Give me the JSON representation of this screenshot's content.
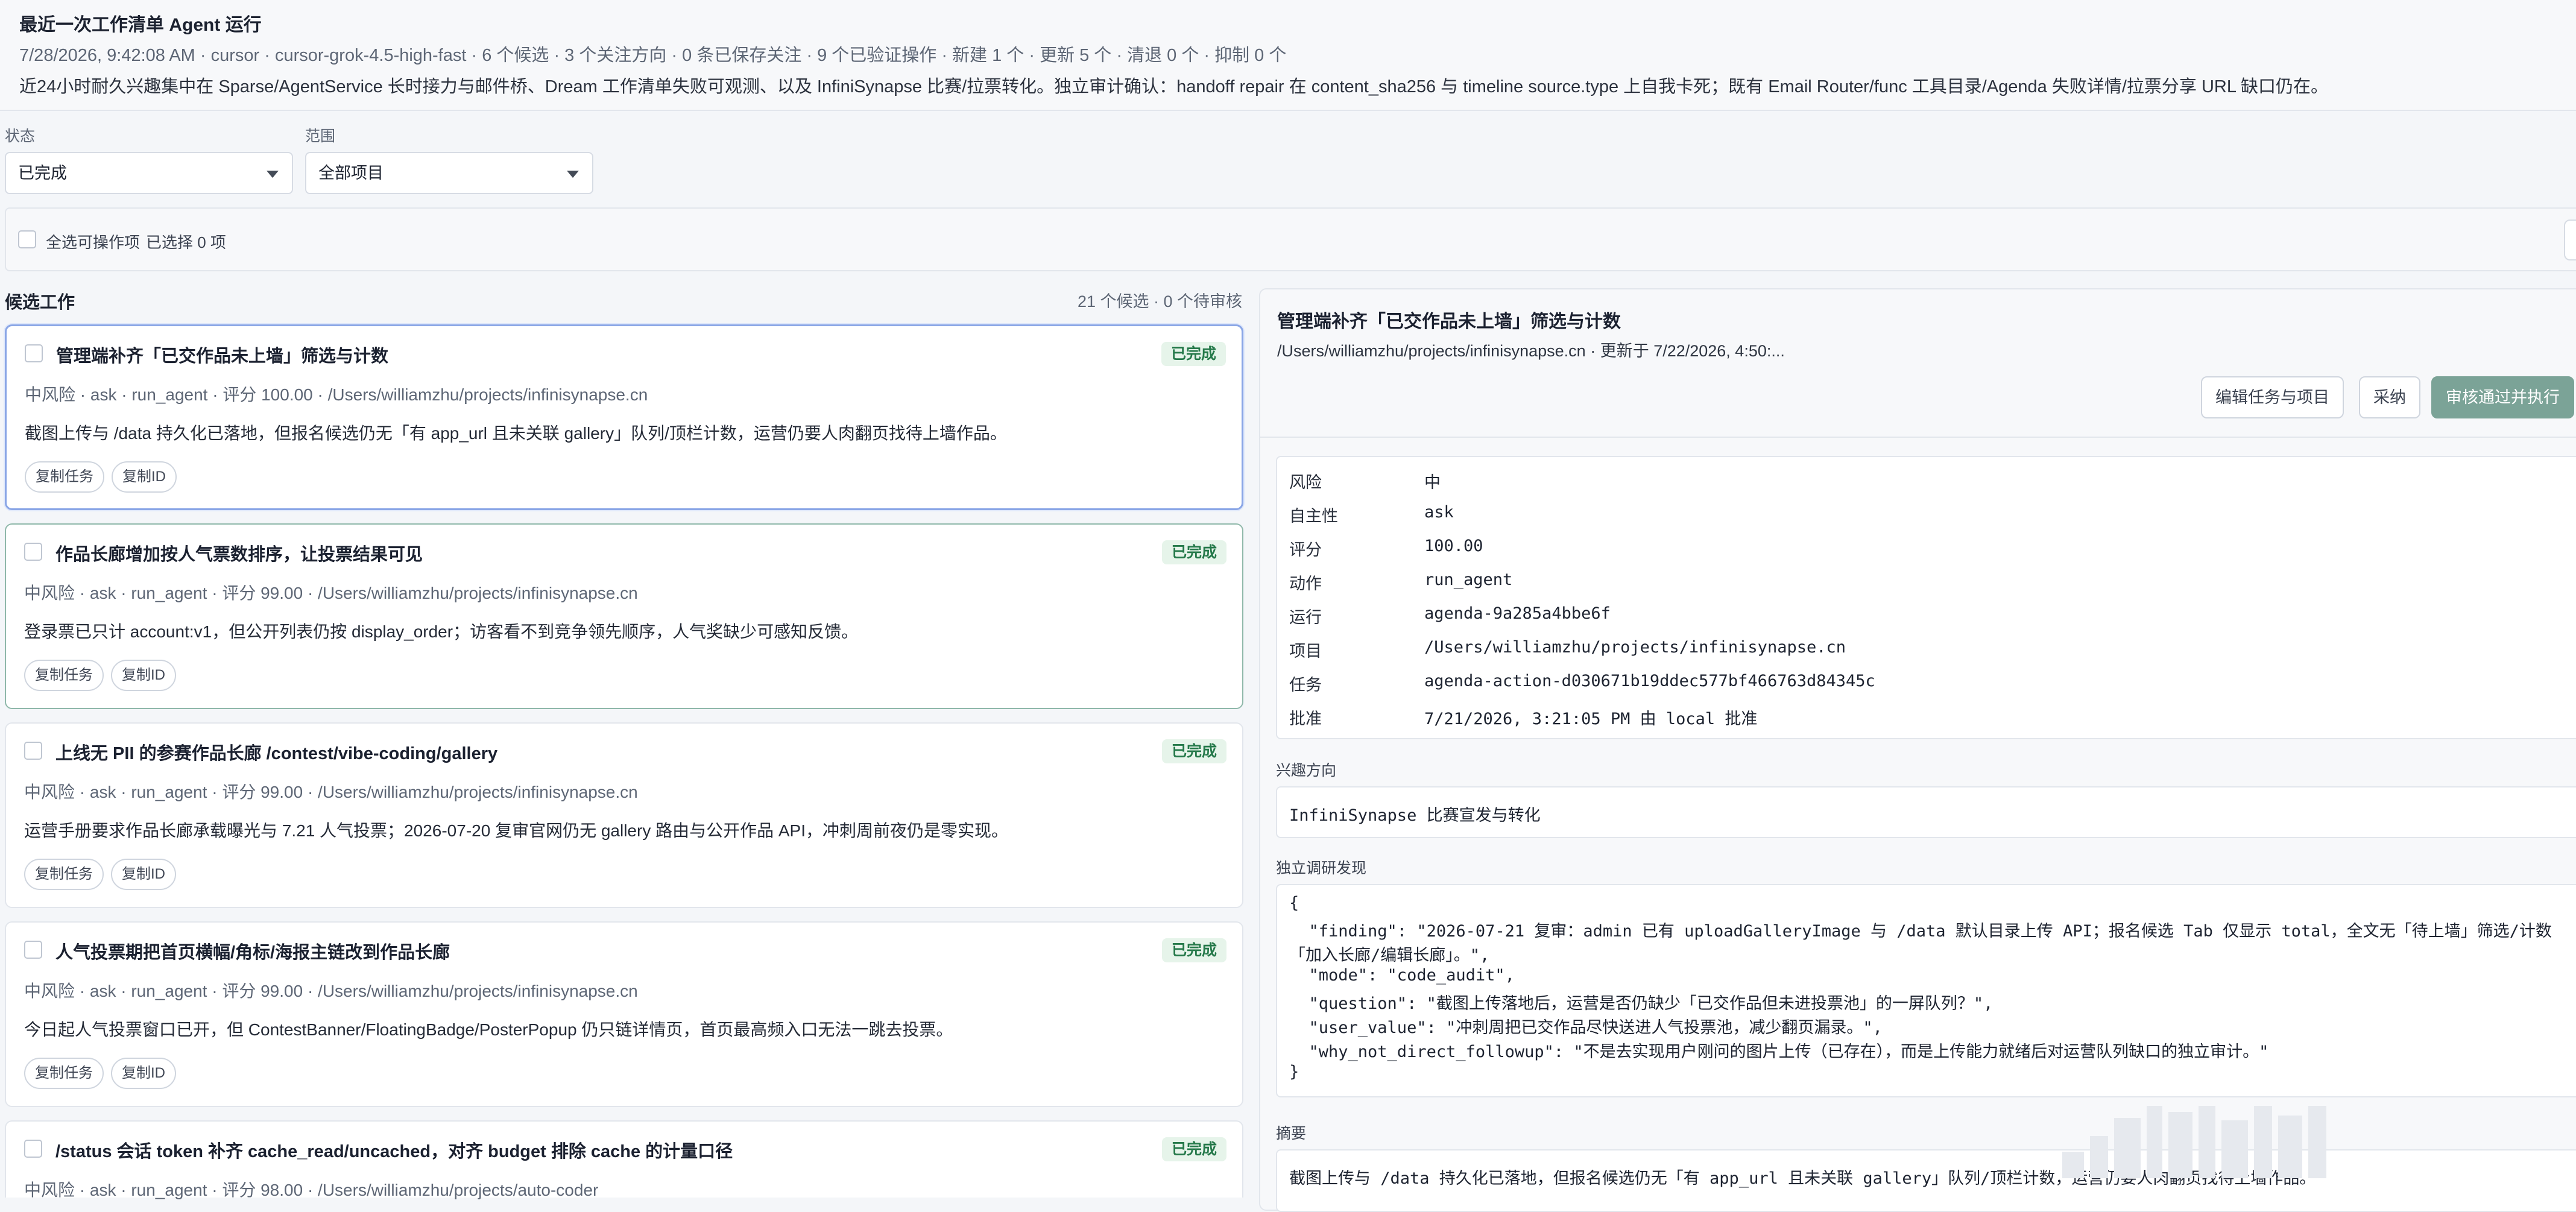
{
  "header": {
    "title": "最近一次工作清单 Agent 运行",
    "meta": "7/28/2026, 9:42:08 AM · cursor · cursor-grok-4.5-high-fast · 6 个候选 · 3 个关注方向 · 0 条已保存关注 · 9 个已验证操作 · 新建 1 个 · 更新 5 个 · 清退 0 个 · 抑制 0 个",
    "summary": "近24小时耐久兴趣集中在 Sparse/AgentService 长时接力与邮件桥、Dream 工作清单失败可观测、以及 InfiniSynapse 比赛/拉票转化。独立审计确认：handoff repair 在 content_sha256 与 timeline source.type 上自我卡死；既有 Email Router/func 工具目录/Agenda 失败详情/拉票分享 URL 缺口仍在。"
  },
  "filters": {
    "status_label": "状态",
    "status_value": "已完成",
    "scope_label": "范围",
    "scope_value": "全部项目"
  },
  "bulk": {
    "select_all_label": "全选可操作项",
    "selected_count": "已选择 0 项"
  },
  "list": {
    "title": "候选工作",
    "counts": "21 个候选 · 0 个待审核",
    "copy_task_label": "复制任务",
    "copy_id_label": "复制ID",
    "items": [
      {
        "title": "管理端补齐「已交作品未上墙」筛选与计数",
        "status": "已完成",
        "meta": "中风险 · ask · run_agent · 评分 100.00 · /Users/williamzhu/projects/infinisynapse.cn",
        "desc": "截图上传与 /data 持久化已落地，但报名候选仍无「有 app_url 且未关联 gallery」队列/顶栏计数，运营仍要人肉翻页找待上墙作品。"
      },
      {
        "title": "作品长廊增加按人气票数排序，让投票结果可见",
        "status": "已完成",
        "meta": "中风险 · ask · run_agent · 评分 99.00 · /Users/williamzhu/projects/infinisynapse.cn",
        "desc": "登录票已只计 account:v1，但公开列表仍按 display_order；访客看不到竞争领先顺序，人气奖缺少可感知反馈。"
      },
      {
        "title": "上线无 PII 的参赛作品长廊 /contest/vibe-coding/gallery",
        "status": "已完成",
        "meta": "中风险 · ask · run_agent · 评分 99.00 · /Users/williamzhu/projects/infinisynapse.cn",
        "desc": "运营手册要求作品长廊承载曝光与 7.21 人气投票；2026-07-20 复审官网仍无 gallery 路由与公开作品 API，冲刺周前夜仍是零实现。"
      },
      {
        "title": "人气投票期把首页横幅/角标/海报主链改到作品长廊",
        "status": "已完成",
        "meta": "中风险 · ask · run_agent · 评分 99.00 · /Users/williamzhu/projects/infinisynapse.cn",
        "desc": "今日起人气投票窗口已开，但 ContestBanner/FloatingBadge/PosterPopup 仍只链详情页，首页最高频入口无法一跳去投票。"
      },
      {
        "title": "/status 会话 token 补齐 cache_read/uncached，对齐 budget 排除 cache 的计量口径",
        "status": "已完成",
        "meta": "中风险 · ask · run_agent · 评分 98.00 · /Users/williamzhu/projects/auto-coder",
        "desc": ""
      }
    ]
  },
  "detail": {
    "title": "管理端补齐「已交作品未上墙」筛选与计数",
    "subtitle": "/Users/williamzhu/projects/infinisynapse.cn · 更新于 7/22/2026, 4:50:...",
    "edit_button": "编辑任务与项目",
    "adopt_button": "采纳",
    "approve_button": "审核通过并执行",
    "fields": [
      {
        "key": "风险",
        "value": "中"
      },
      {
        "key": "自主性",
        "value": "ask"
      },
      {
        "key": "评分",
        "value": "100.00"
      },
      {
        "key": "动作",
        "value": "run_agent"
      },
      {
        "key": "运行",
        "value": "agenda-9a285a4bbe6f"
      },
      {
        "key": "项目",
        "value": "/Users/williamzhu/projects/infinisynapse.cn"
      },
      {
        "key": "任务",
        "value": "agenda-action-d030671b19ddec577bf466763d84345c"
      },
      {
        "key": "批准",
        "value": "7/21/2026, 3:21:05 PM 由 local 批准"
      }
    ],
    "interest_label": "兴趣方向",
    "interest_value": "InfiniSynapse 比赛宣发与转化",
    "finding_label": "独立调研发现",
    "finding_lines": [
      "{",
      "  \"finding\": \"2026-07-21 复审：admin 已有 uploadGalleryImage 与 /data 默认目录上传 API；报名候选 Tab 仅显示 total，全文无「待上墙」筛选/计数",
      "「加入长廊/编辑长廊」。\",",
      "  \"mode\": \"code_audit\",",
      "  \"question\": \"截图上传落地后，运营是否仍缺少「已交作品但未进投票池」的一屏队列？\",",
      "  \"user_value\": \"冲刺周把已交作品尽快送进人气投票池，减少翻页漏录。\",",
      "  \"why_not_direct_followup\": \"不是去实现用户刚问的图片上传（已存在），而是上传能力就绪后对运营队列缺口的独立审计。\"",
      "}"
    ],
    "summary_label": "摘要",
    "summary_value": "截图上传与 /data 持久化已落地，但报名候选仍无「有 app_url 且未关联 gallery」队列/顶栏计数，运营仍要人肉翻页找待上墙作品。"
  }
}
